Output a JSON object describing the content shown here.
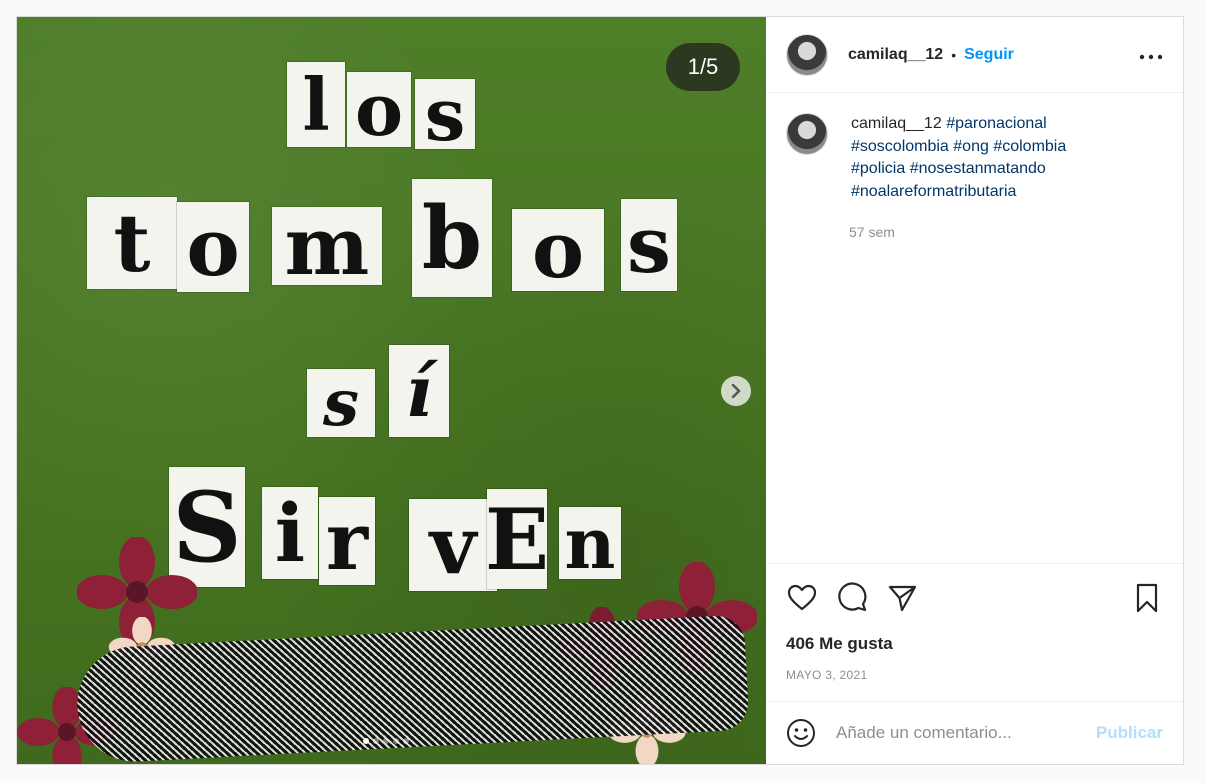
{
  "media": {
    "counter": "1/5",
    "words": {
      "line1": "los",
      "line2": "tombos",
      "line3": "sí",
      "line4": "sirven"
    }
  },
  "author": {
    "username": "camilaq__12",
    "follow_label": "Seguir",
    "separator": "•",
    "more_label": "•••"
  },
  "caption": {
    "username": "camilaq__12",
    "hashtags": [
      "#paronacional",
      "#soscolombia",
      "#ong",
      "#colombia",
      "#policia",
      "#nosestanmatando",
      "#noalareformatributaria"
    ],
    "time": "57 sem"
  },
  "stats": {
    "likes": "406 Me gusta",
    "date": "MAYO 3, 2021"
  },
  "comment_box": {
    "placeholder": "Añade un comentario...",
    "publish_label": "Publicar"
  },
  "icons": {
    "like": "heart-icon",
    "comment": "comment-icon",
    "share": "send-icon",
    "save": "bookmark-icon",
    "emoji": "emoji-icon",
    "next": "chevron-right-icon"
  },
  "colors": {
    "accent": "#0095f6",
    "hashtag": "#00376b",
    "media_bg": "#4b7a26"
  }
}
